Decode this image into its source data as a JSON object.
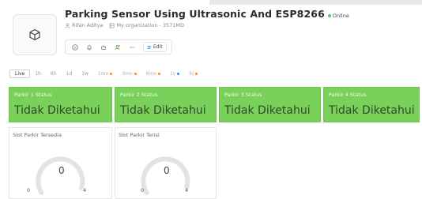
{
  "header": {
    "title": "Parking Sensor Using Ultrasonic And ESP8266",
    "status": "Online",
    "owner": "Rifan Aditya",
    "org": "My organization - 3571MD",
    "edit_label": "Edit"
  },
  "time_ranges": [
    {
      "label": "Live",
      "active": true
    },
    {
      "label": "1h"
    },
    {
      "label": "6h"
    },
    {
      "label": "1d"
    },
    {
      "label": "1w"
    },
    {
      "label": "1mo",
      "dot": "#f08a24"
    },
    {
      "label": "3mo",
      "dot": "#f08a24"
    },
    {
      "label": "6mo",
      "dot": "#f08a24"
    },
    {
      "label": "1y",
      "dot": "#3a86e8"
    },
    {
      "label": "6|",
      "dot": "#f08a24"
    }
  ],
  "status_cards": [
    {
      "label": "Parkir 1 Status",
      "value": "Tidak Diketahui"
    },
    {
      "label": "Parkir 2 Status",
      "value": "Tidak Diketahui"
    },
    {
      "label": "Parkir 3 Status",
      "value": "Tidak Diketahui"
    },
    {
      "label": "Parkir 4 Status",
      "value": "Tidak Diketahui"
    }
  ],
  "gauges": [
    {
      "label": "Slot Parkir Tersedia",
      "value": "0",
      "min": "0",
      "max": "4"
    },
    {
      "label": "Slot Parkir Terisi",
      "value": "0",
      "min": "0",
      "max": "4"
    }
  ],
  "colors": {
    "card_green": "#79d15c",
    "online_dot": "#5cc86b"
  }
}
